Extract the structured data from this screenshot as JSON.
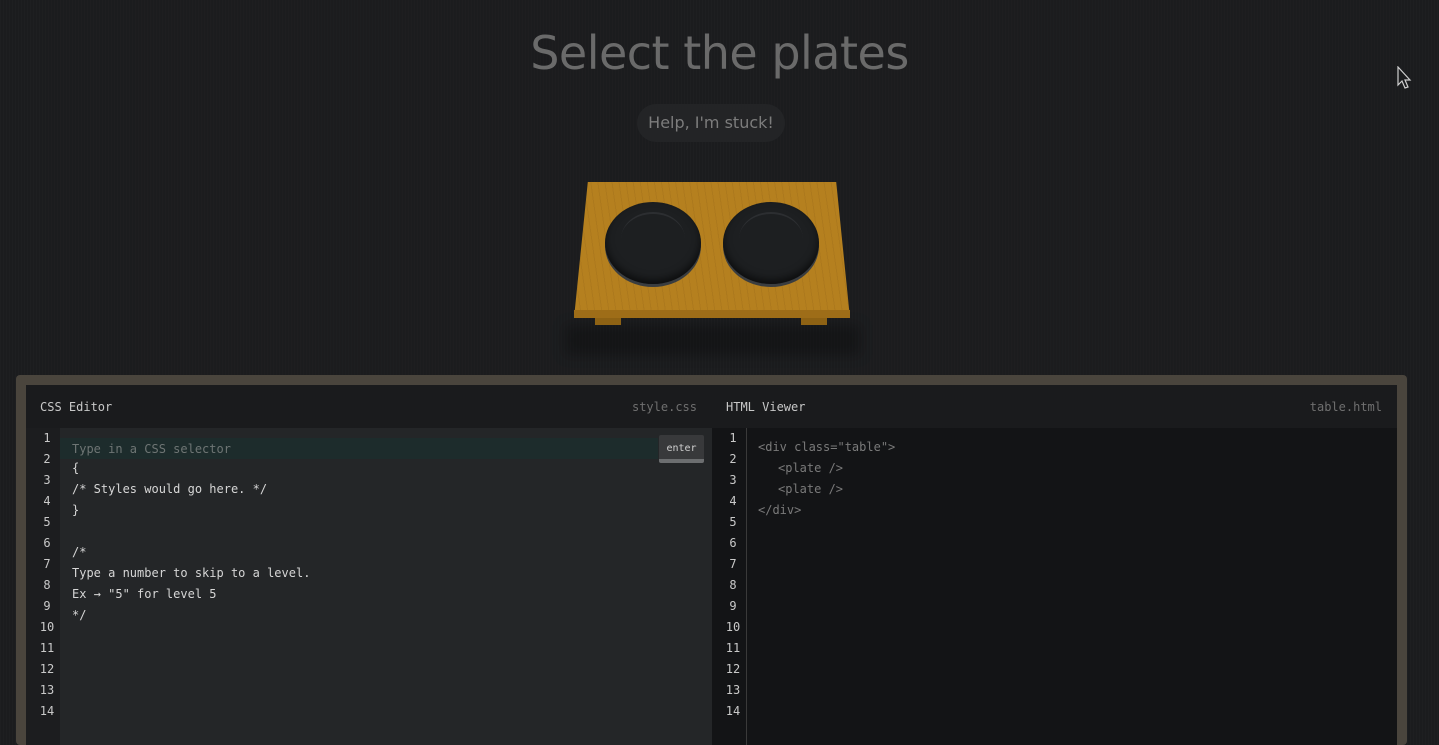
{
  "page": {
    "title": "Select the plates",
    "help_label": "Help, I'm stuck!"
  },
  "css_editor": {
    "title": "CSS Editor",
    "filename": "style.css",
    "input_placeholder": "Type in a CSS selector",
    "input_value": "",
    "enter_label": "enter",
    "lines": [
      "{",
      "/* Styles would go here. */",
      "}",
      "",
      "/*",
      "Type a number to skip to a level.",
      "Ex → \"5\" for level 5",
      "*/"
    ],
    "line_numbers": [
      "1",
      "2",
      "3",
      "4",
      "5",
      "6",
      "7",
      "8",
      "9",
      "10",
      "11",
      "12",
      "13",
      "14"
    ]
  },
  "html_viewer": {
    "title": "HTML Viewer",
    "filename": "table.html",
    "lines": [
      "<div class=\"table\">",
      "<plate />",
      "<plate />",
      "</div>"
    ],
    "line_numbers": [
      "1",
      "2",
      "3",
      "4",
      "5",
      "6",
      "7",
      "8",
      "9",
      "10",
      "11",
      "12",
      "13",
      "14"
    ]
  },
  "colors": {
    "table_wood": "#b5801f",
    "plate": "#1d1f21",
    "frame": "#4a453d"
  },
  "icons": {
    "cursor": "arrow-cursor-icon"
  }
}
